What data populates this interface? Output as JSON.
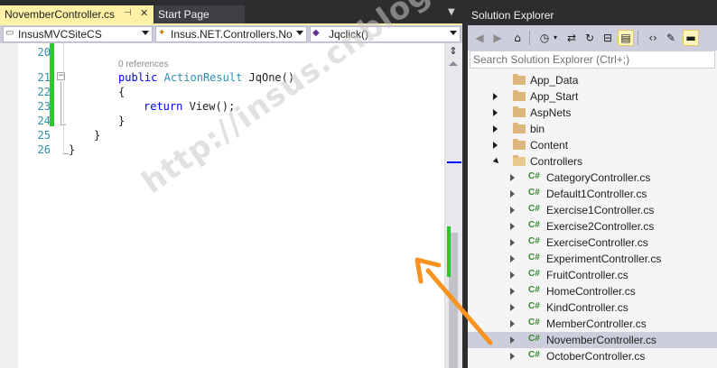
{
  "editor": {
    "tabs": [
      {
        "label": "NovemberController.cs",
        "active": true
      },
      {
        "label": "Start Page",
        "active": false
      }
    ],
    "tab_pin_icon": "pin-icon",
    "navbar": {
      "project": "InsusMVCSiteCS",
      "class": "Insus.NET.Controllers.No",
      "member": "Jqclick()"
    },
    "line_numbers": [
      "20",
      "21",
      "22",
      "23",
      "24",
      "25",
      "26"
    ],
    "code_lens": "0 references",
    "code": {
      "line21_kw": "public",
      "line21_type": "ActionResult",
      "line21_name": "JqOne()",
      "line22": "{",
      "line23_kw": "return",
      "line23_rest": "View();",
      "line24": "}",
      "line25": "}",
      "line26": "}"
    }
  },
  "solution_explorer": {
    "title": "Solution Explorer",
    "search_placeholder": "Search Solution Explorer (Ctrl+;)",
    "toolbar_icons": [
      "back-icon",
      "forward-icon",
      "home-icon",
      "history-icon",
      "sync-icon",
      "refresh-icon",
      "collapse-all-icon",
      "show-all-files-icon",
      "view-code-icon",
      "properties-icon",
      "preview-icon"
    ],
    "tree": [
      {
        "label": "App_Data",
        "kind": "folder",
        "expander": "none"
      },
      {
        "label": "App_Start",
        "kind": "folder",
        "expander": "collapsed"
      },
      {
        "label": "AspNets",
        "kind": "folder",
        "expander": "collapsed"
      },
      {
        "label": "bin",
        "kind": "folder",
        "expander": "collapsed"
      },
      {
        "label": "Content",
        "kind": "folder",
        "expander": "collapsed"
      },
      {
        "label": "Controllers",
        "kind": "folder",
        "expander": "expanded"
      },
      {
        "label": "CategoryController.cs",
        "kind": "cs"
      },
      {
        "label": "Default1Controller.cs",
        "kind": "cs"
      },
      {
        "label": "Exercise1Controller.cs",
        "kind": "cs"
      },
      {
        "label": "Exercise2Controller.cs",
        "kind": "cs"
      },
      {
        "label": "ExerciseController.cs",
        "kind": "cs"
      },
      {
        "label": "ExperimentController.cs",
        "kind": "cs"
      },
      {
        "label": "FruitController.cs",
        "kind": "cs"
      },
      {
        "label": "HomeController.cs",
        "kind": "cs"
      },
      {
        "label": "KindController.cs",
        "kind": "cs"
      },
      {
        "label": "MemberController.cs",
        "kind": "cs"
      },
      {
        "label": "NovemberController.cs",
        "kind": "cs",
        "selected": true
      },
      {
        "label": "OctoberController.cs",
        "kind": "cs"
      }
    ],
    "cs_badge": "C#"
  },
  "watermark": "http://insus.cnblogs.com",
  "colors": {
    "active_tab": "#fff1a5",
    "change_bar": "#28c928",
    "keyword": "#0000ff",
    "type": "#2b91af",
    "line_number": "#2b91af",
    "arrow": "#f7931e",
    "selection": "#cccedb"
  }
}
